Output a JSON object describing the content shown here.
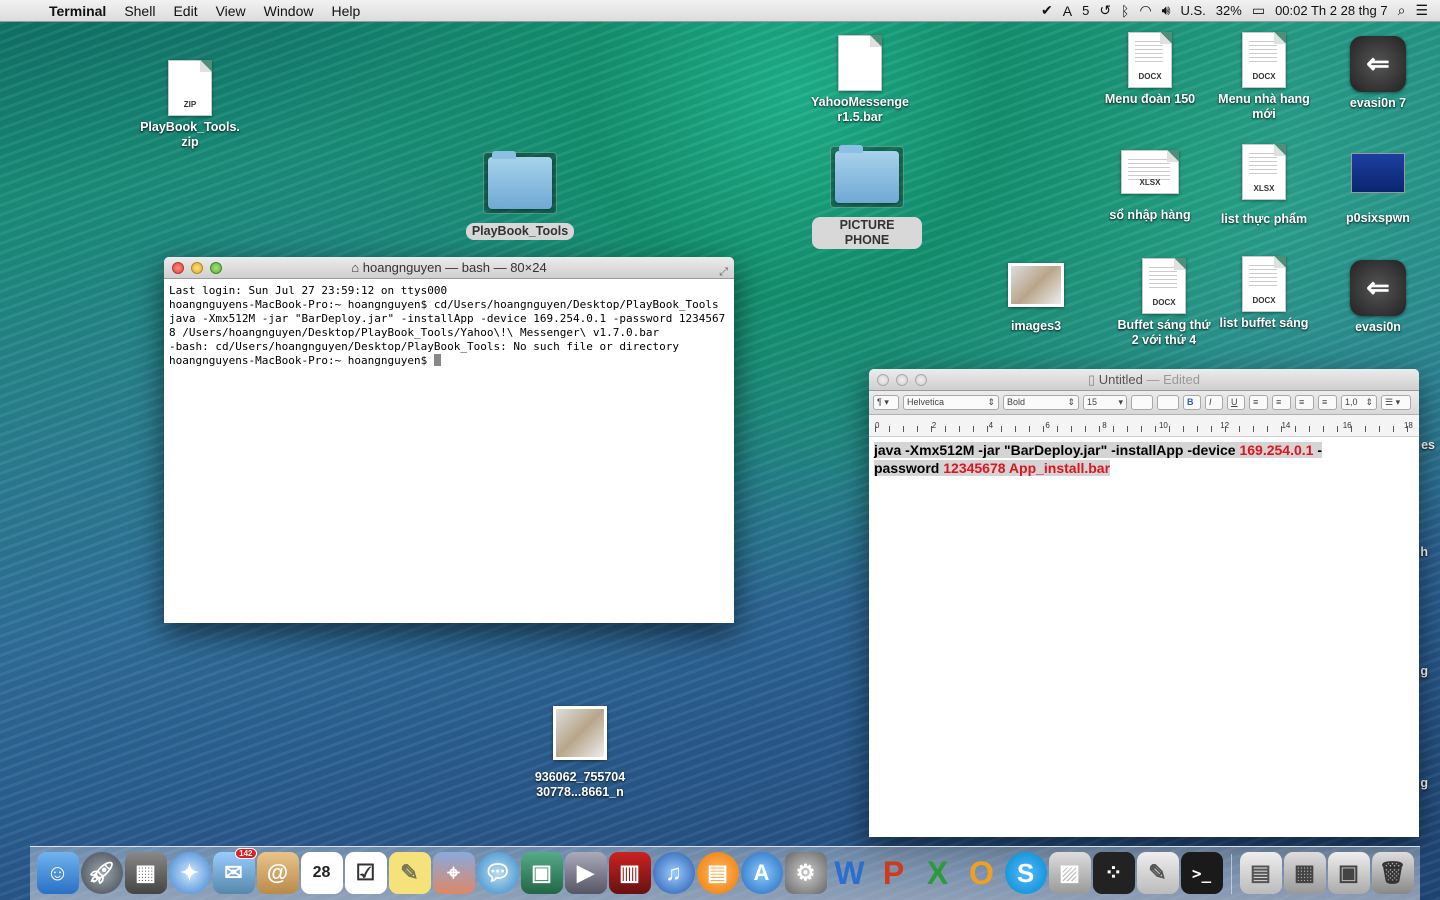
{
  "menubar": {
    "app": "Terminal",
    "menus": [
      "Shell",
      "Edit",
      "View",
      "Window",
      "Help"
    ],
    "status": {
      "notifications": "5",
      "input": "U.S.",
      "battery": "32%",
      "clock": "00:02 Th 2 28 thg 7"
    }
  },
  "desktop": {
    "playbook_zip": "PlayBook_Tools.\nzip",
    "playbook_folder": "PlayBook_Tools",
    "yahoo": "YahooMessenge\nr1.5.bar",
    "picture_phone": "PICTURE PHONE",
    "menu_doan": "Menu đoàn  150",
    "menu_nha_hang": "Menu nhà hang\nmới",
    "evasi0n7": "evasi0n 7",
    "so_nhap_hang": "sổ nhập hàng",
    "list_thuc_pham": "list thực phẩm",
    "p0sixspwn": "p0sixspwn",
    "images3": "images3",
    "buffet_sang": "Buffet sáng thứ\n2 với thứ 4",
    "list_buffet": "list buffet sáng",
    "evasi0n": "evasi0n",
    "photo_file": "936062_755704\n30778...8661_n",
    "partial_es": "es",
    "partial_h": "h",
    "partial_g": "g",
    "partial_g2": "g",
    "tag_zip": "ZIP",
    "tag_docx": "DOCX",
    "tag_xlsx": "XLSX"
  },
  "terminal": {
    "title": "hoangnguyen — bash — 80×24",
    "lines": "Last login: Sun Jul 27 23:59:12 on ttys000\nhoangnguyens-MacBook-Pro:~ hoangnguyen$ cd/Users/hoangnguyen/Desktop/PlayBook_Tools java -Xmx512M -jar \"BarDeploy.jar\" -installApp -device 169.254.0.1 -password 12345678 /Users/hoangnguyen/Desktop/PlayBook_Tools/Yahoo\\!\\ Messenger\\ v1.7.0.bar\n-bash: cd/Users/hoangnguyen/Desktop/PlayBook_Tools: No such file or directory\nhoangnguyens-MacBook-Pro:~ hoangnguyen$ "
  },
  "textedit": {
    "title": "Untitled",
    "title_state": " — Edited",
    "font": "Helvetica",
    "style": "Bold",
    "size": "15",
    "spacing": "1,0",
    "ruler": [
      "0",
      "2",
      "4",
      "6",
      "8",
      "10",
      "12",
      "14",
      "16",
      "18"
    ],
    "text_part1": "java -Xmx512M -jar \"BarDeploy.jar\" -installApp -device ",
    "text_ip": "169.254.0.1",
    "text_part2": " -",
    "text_part3": "password ",
    "text_pass": "12345678 App_install.bar"
  },
  "dock": {
    "mail_badge": "142",
    "calendar_day": "28"
  }
}
